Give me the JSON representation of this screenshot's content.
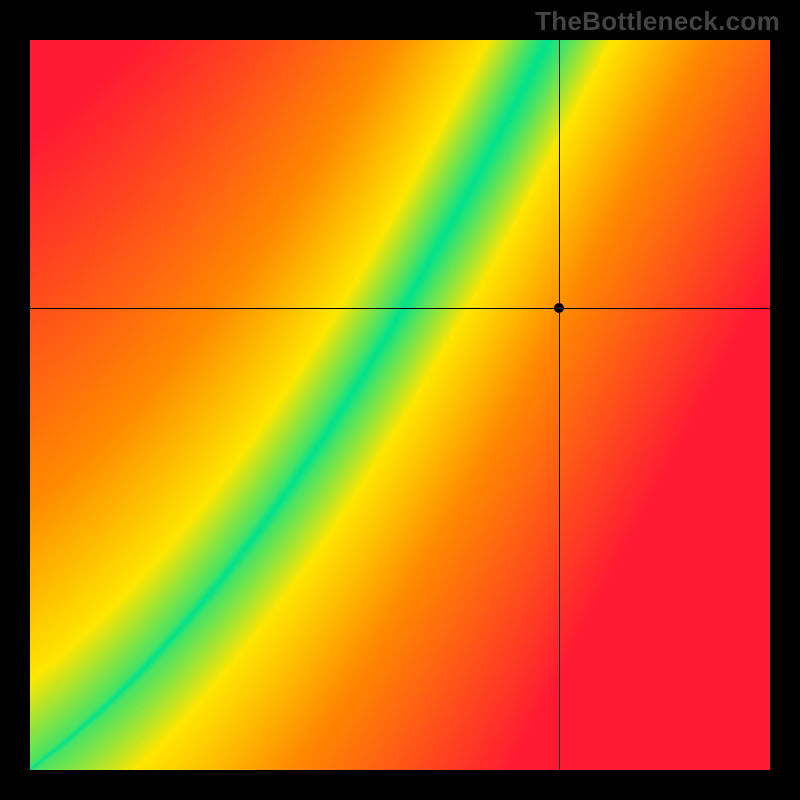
{
  "watermark": "TheBottleneck.com",
  "chart_data": {
    "type": "heatmap",
    "title": "",
    "xlabel": "",
    "ylabel": "",
    "xlim": [
      0,
      1
    ],
    "ylim": [
      0,
      1
    ],
    "crosshair": {
      "x": 0.715,
      "y": 0.633
    },
    "marker": {
      "x": 0.715,
      "y": 0.633
    },
    "ridge_points": [
      {
        "x": 0.0,
        "y": 0.0
      },
      {
        "x": 0.05,
        "y": 0.04
      },
      {
        "x": 0.1,
        "y": 0.085
      },
      {
        "x": 0.15,
        "y": 0.135
      },
      {
        "x": 0.2,
        "y": 0.19
      },
      {
        "x": 0.25,
        "y": 0.25
      },
      {
        "x": 0.3,
        "y": 0.315
      },
      {
        "x": 0.35,
        "y": 0.385
      },
      {
        "x": 0.4,
        "y": 0.46
      },
      {
        "x": 0.45,
        "y": 0.54
      },
      {
        "x": 0.5,
        "y": 0.625
      },
      {
        "x": 0.55,
        "y": 0.715
      },
      {
        "x": 0.6,
        "y": 0.805
      },
      {
        "x": 0.65,
        "y": 0.9
      },
      {
        "x": 0.7,
        "y": 1.0
      }
    ],
    "ridge_width": [
      {
        "x": 0.0,
        "w": 0.01
      },
      {
        "x": 0.1,
        "w": 0.018
      },
      {
        "x": 0.2,
        "w": 0.028
      },
      {
        "x": 0.3,
        "w": 0.04
      },
      {
        "x": 0.4,
        "w": 0.055
      },
      {
        "x": 0.5,
        "w": 0.07
      },
      {
        "x": 0.6,
        "w": 0.085
      },
      {
        "x": 0.7,
        "w": 0.1
      }
    ],
    "color_stops": {
      "green": "#00e28c",
      "yellow": "#ffe600",
      "orange": "#ff8a00",
      "red": "#ff1a33"
    }
  }
}
